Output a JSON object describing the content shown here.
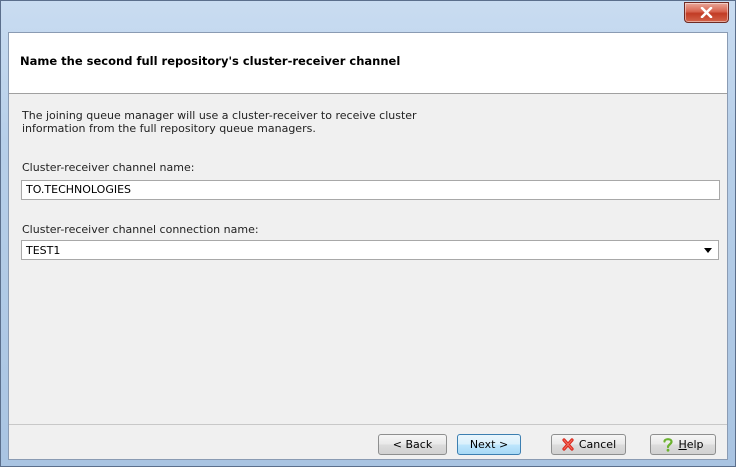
{
  "window": {
    "close_label": "Close"
  },
  "header": {
    "title": "Name the second full repository's cluster-receiver channel"
  },
  "content": {
    "description_line1": "The joining queue manager will use a cluster-receiver to receive cluster",
    "description_line2": "information from the full repository queue managers.",
    "channel_name_label": "Cluster-receiver channel name:",
    "channel_name_value": "TO.TECHNOLOGIES",
    "connection_name_label": "Cluster-receiver channel connection name:",
    "connection_name_value": "TEST1"
  },
  "footer": {
    "back_label": "< Back",
    "next_label": "Next >",
    "cancel_label": "Cancel",
    "help_prefix": "",
    "help_mnemonic": "H",
    "help_rest": "elp"
  },
  "icons": {
    "close": "close-x-icon",
    "cancel": "red-x-icon",
    "help": "question-mark-icon",
    "dropdown": "chevron-down-icon"
  },
  "colors": {
    "close_button": "#c13b24",
    "cancel_icon": "#d9261c",
    "help_icon": "#6cb230"
  }
}
